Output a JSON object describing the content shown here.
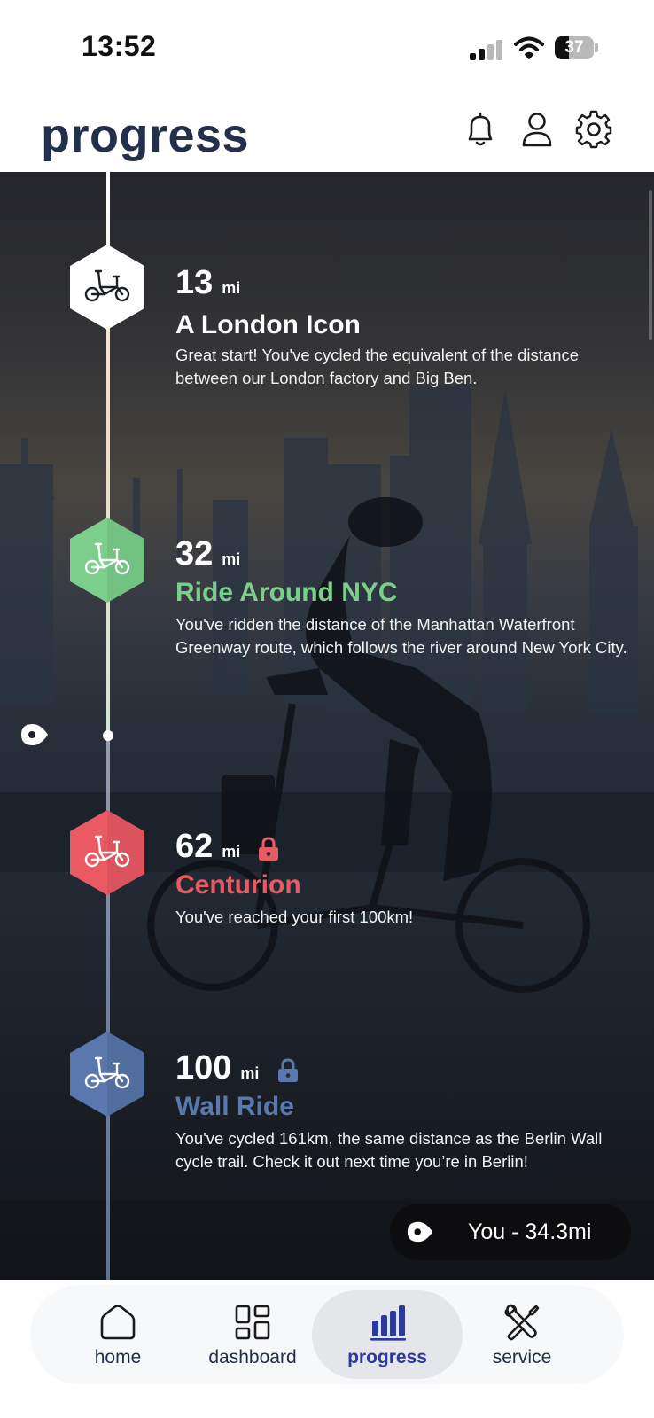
{
  "status_bar": {
    "time": "13:52",
    "battery_level": "37",
    "icons": [
      "signal-icon",
      "wifi-icon",
      "battery-icon"
    ]
  },
  "header": {
    "title": "progress",
    "icons": [
      "bell-icon",
      "profile-icon",
      "gear-icon"
    ]
  },
  "milestones": [
    {
      "distance": "13",
      "unit": "mi",
      "title": "A London Icon",
      "description": "Great start! You've cycled the equivalent of the distance between our London factory and Big Ben.",
      "color": "#ffffff",
      "locked": false
    },
    {
      "distance": "32",
      "unit": "mi",
      "title": "Ride Around NYC",
      "description": "You've ridden the distance of the Manhattan Waterfront Greenway route, which follows the river around New York City.",
      "color": "#7ccf8a",
      "locked": false
    },
    {
      "distance": "62",
      "unit": "mi",
      "title": "Centurion",
      "description": "You've reached your first 100km!",
      "color": "#e95a63",
      "locked": true
    },
    {
      "distance": "100",
      "unit": "mi",
      "title": "Wall Ride",
      "description": "You've cycled 161km, the same distance as the Berlin Wall cycle trail. Check it out next time you’re in Berlin!",
      "color": "#5a78ad",
      "locked": true
    }
  ],
  "you_pill": {
    "label": "You - 34.3mi"
  },
  "bottom_nav": {
    "items": [
      {
        "label": "home",
        "icon": "home-icon",
        "active": false
      },
      {
        "label": "dashboard",
        "icon": "dashboard-icon",
        "active": false
      },
      {
        "label": "progress",
        "icon": "bar-chart-icon",
        "active": true
      },
      {
        "label": "service",
        "icon": "wrench-screwdriver-icon",
        "active": false
      }
    ]
  },
  "colors": {
    "brand_navy": "#22304c",
    "active_nav": "#2c3a9a",
    "milestone_green": "#7ccf8a",
    "milestone_red": "#e95a63",
    "milestone_blue": "#5a78ad"
  }
}
